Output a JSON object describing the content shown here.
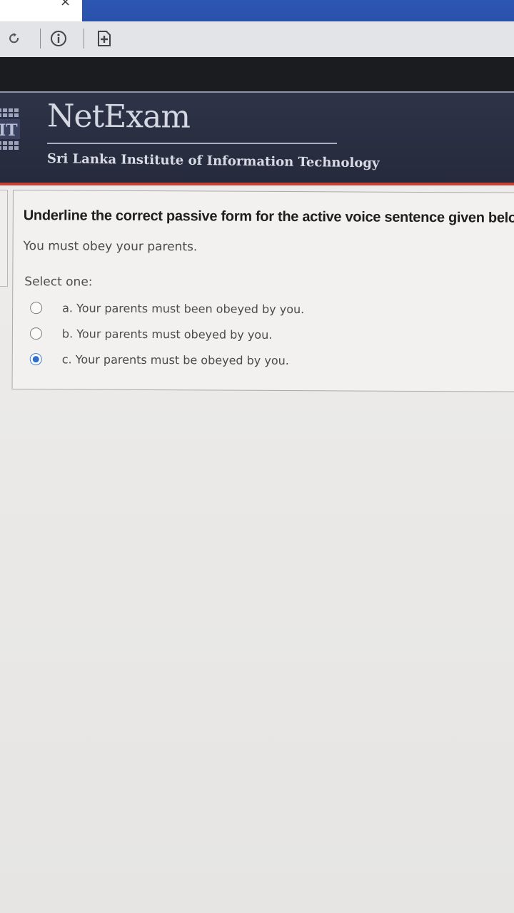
{
  "browser": {
    "close_glyph": "×",
    "icons": [
      "reload-icon",
      "info-icon",
      "add-page-icon"
    ]
  },
  "header": {
    "logo_text": "IT",
    "brand": "NetExam",
    "institute": "Sri Lanka Institute of Information Technology",
    "colors": {
      "background": "#2a2e42",
      "accent": "#c34236"
    }
  },
  "question": {
    "prompt": "Underline the correct passive form for the active voice sentence given below",
    "sentence": "You must obey your parents.",
    "select_label": "Select one:",
    "options": [
      {
        "label": "a. Your parents must been obeyed by you.",
        "selected": false
      },
      {
        "label": "b. Your parents must obeyed by you.",
        "selected": false
      },
      {
        "label": "c. Your parents must be obeyed by you.",
        "selected": true
      }
    ]
  }
}
